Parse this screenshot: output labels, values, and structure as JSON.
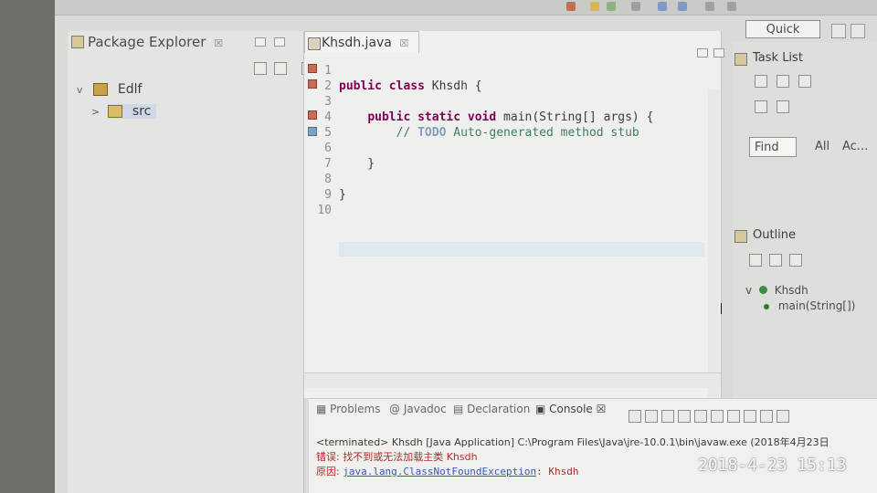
{
  "colors": {
    "background": "#d9dbd9",
    "editor_bg": "#efefed",
    "keyword": "#7f0055",
    "comment": "#3f7f5f",
    "todo": "#7f9fbf",
    "error": "#b52a2a",
    "link": "#3658b7"
  },
  "toolbar": {
    "quick_access_label": "Quick Access"
  },
  "package_explorer": {
    "title": "Package Explorer",
    "close_label": "☒",
    "tree": [
      {
        "label": "Edlf",
        "caret": "v"
      },
      {
        "label": "src",
        "caret": ">"
      }
    ],
    "icons": [
      "collapse-all-icon",
      "link-editor-icon",
      "focus-icon",
      "view-menu-icon"
    ]
  },
  "editor": {
    "tab_label": "Khsdh.java",
    "close_label": "☒",
    "lines": [
      {
        "num": "1",
        "parts": []
      },
      {
        "num": "2",
        "parts": [
          {
            "t": "kw",
            "v": "public"
          },
          {
            "t": "txt",
            "v": " "
          },
          {
            "t": "kw",
            "v": "class"
          },
          {
            "t": "txt",
            "v": " Khsdh {"
          }
        ]
      },
      {
        "num": "3",
        "parts": []
      },
      {
        "num": "4",
        "parts": [
          {
            "t": "txt",
            "v": "    "
          },
          {
            "t": "kw",
            "v": "public"
          },
          {
            "t": "txt",
            "v": " "
          },
          {
            "t": "kw",
            "v": "static"
          },
          {
            "t": "txt",
            "v": " "
          },
          {
            "t": "kw",
            "v": "void"
          },
          {
            "t": "txt",
            "v": " main(String[] args) {"
          }
        ]
      },
      {
        "num": "5",
        "parts": [
          {
            "t": "txt",
            "v": "        "
          },
          {
            "t": "comment",
            "v": "// "
          },
          {
            "t": "todo",
            "v": "TODO"
          },
          {
            "t": "comment",
            "v": " Auto-generated method stub"
          }
        ]
      },
      {
        "num": "6",
        "parts": []
      },
      {
        "num": "7",
        "parts": [
          {
            "t": "txt",
            "v": "    }"
          }
        ]
      },
      {
        "num": "8",
        "parts": []
      },
      {
        "num": "9",
        "parts": [
          {
            "t": "txt",
            "v": "}"
          }
        ]
      },
      {
        "num": "10",
        "parts": []
      }
    ]
  },
  "task_list": {
    "title": "Task List",
    "find_label": "Find",
    "all_label": "All",
    "activate_label": "Ac..."
  },
  "outline": {
    "title": "Outline",
    "class_name": "Khsdh",
    "method_name": "main(String[])"
  },
  "console": {
    "tabs": [
      {
        "label": "Problems",
        "active": false
      },
      {
        "label": "Javadoc",
        "active": false
      },
      {
        "label": "Declaration",
        "active": false
      },
      {
        "label": "Console",
        "active": true
      }
    ],
    "header": "<terminated> Khsdh [Java Application] C:\\Program Files\\Java\\jre-10.0.1\\bin\\javaw.exe (2018年4月23日",
    "error_line_1": "错误: 找不到或无法加载主类 Khsdh",
    "error_prefix_2": "原因: ",
    "error_link_2": "java.lang.ClassNotFoundException",
    "error_suffix_2": ": Khsdh"
  },
  "timestamp": "2018-4-23 15:13"
}
